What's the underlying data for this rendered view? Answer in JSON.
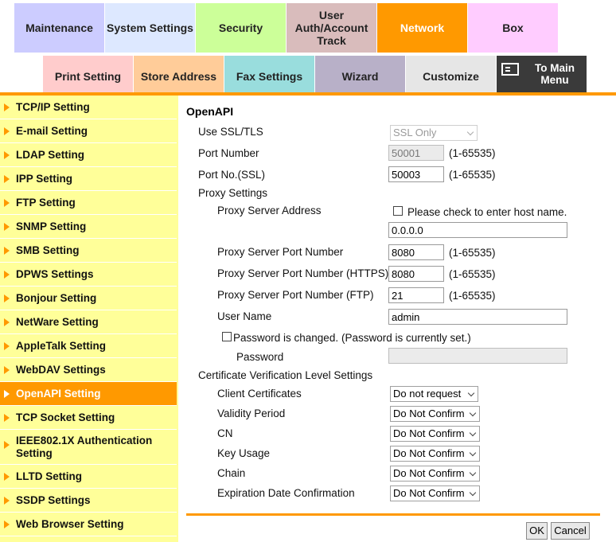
{
  "top_tabs": [
    "Maintenance",
    "System Settings",
    "Security",
    "User Auth/Account Track",
    "Network",
    "Box"
  ],
  "sub_tabs": [
    "Print Setting",
    "Store Address",
    "Fax Settings",
    "Wizard",
    "Customize"
  ],
  "to_main_menu": "To Main Menu",
  "nav_items": [
    "TCP/IP Setting",
    "E-mail Setting",
    "LDAP Setting",
    "IPP Setting",
    "FTP Setting",
    "SNMP Setting",
    "SMB Setting",
    "DPWS Settings",
    "Bonjour Setting",
    "NetWare Setting",
    "AppleTalk Setting",
    "WebDAV Settings",
    "OpenAPI Setting",
    "TCP Socket Setting",
    "IEEE802.1X Authentication Setting",
    "LLTD Setting",
    "SSDP Settings",
    "Web Browser Setting"
  ],
  "active_nav": "OpenAPI Setting",
  "form": {
    "title": "OpenAPI",
    "use_ssl_label": "Use SSL/TLS",
    "use_ssl_value": "SSL Only",
    "port_label": "Port Number",
    "port_value": "50001",
    "port_range": "(1-65535)",
    "port_ssl_label": "Port No.(SSL)",
    "port_ssl_value": "50003",
    "port_ssl_range": "(1-65535)",
    "proxy_settings_label": "Proxy Settings",
    "proxy_address_label": "Proxy Server Address",
    "proxy_host_check_label": "Please check to enter host name.",
    "proxy_address_value": "0.0.0.0",
    "proxy_port_label": "Proxy Server Port Number",
    "proxy_port_value": "8080",
    "proxy_port_range": "(1-65535)",
    "proxy_port_https_label": "Proxy Server Port Number (HTTPS)",
    "proxy_port_https_value": "8080",
    "proxy_port_https_range": "(1-65535)",
    "proxy_port_ftp_label": "Proxy Server Port Number (FTP)",
    "proxy_port_ftp_value": "21",
    "proxy_port_ftp_range": "(1-65535)",
    "user_name_label": "User Name",
    "user_name_value": "admin",
    "password_changed_label": "Password is changed.",
    "password_status": "(Password is currently set.)",
    "password_label": "Password",
    "password_value": "",
    "cert_level_label": "Certificate Verification Level Settings",
    "client_cert_label": "Client Certificates",
    "client_cert_value": "Do not request",
    "validity_label": "Validity Period",
    "validity_value": "Do Not Confirm",
    "cn_label": "CN",
    "cn_value": "Do Not Confirm",
    "key_usage_label": "Key Usage",
    "key_usage_value": "Do Not Confirm",
    "chain_label": "Chain",
    "chain_value": "Do Not Confirm",
    "expiration_label": "Expiration Date Confirmation",
    "expiration_value": "Do Not Confirm"
  },
  "buttons": {
    "ok": "OK",
    "cancel": "Cancel"
  },
  "colors": {
    "accent": "#ff9900",
    "nav_bg": "#ffff99"
  }
}
